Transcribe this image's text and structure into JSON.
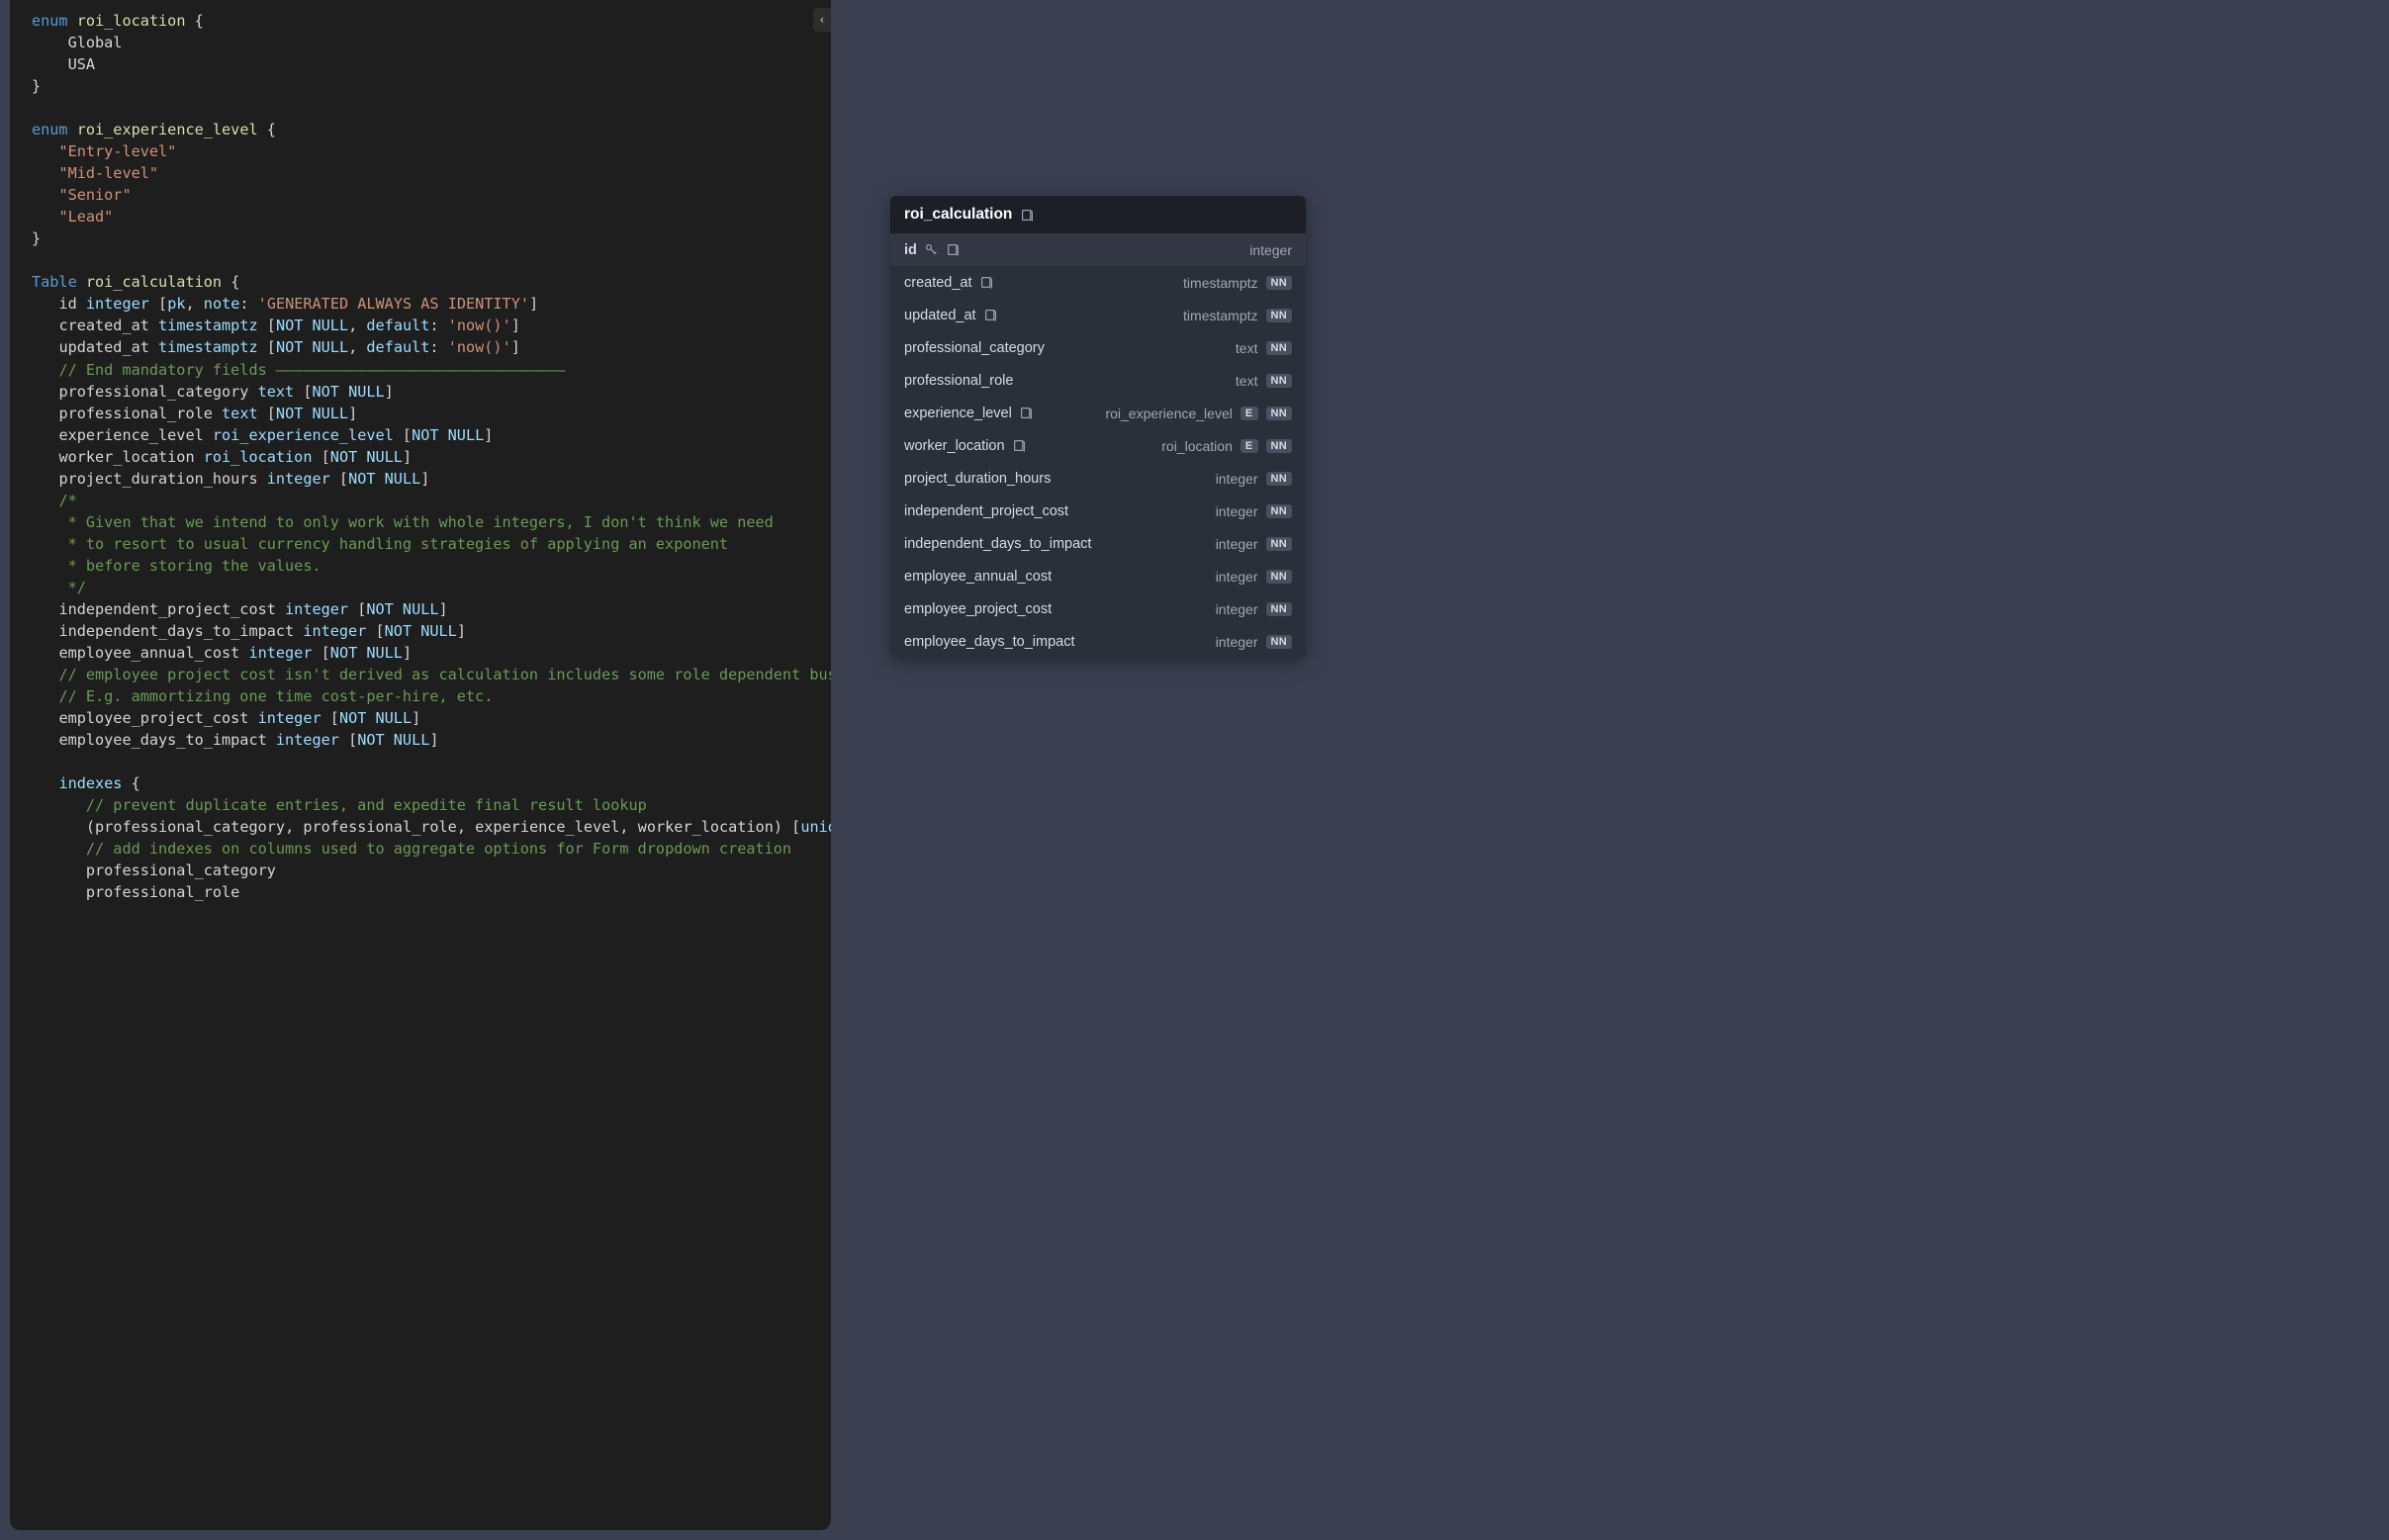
{
  "editor": {
    "code_tokens": [
      [
        [
          "kw",
          "enum"
        ],
        [
          "wht",
          " "
        ],
        [
          "id",
          "roi_location"
        ],
        [
          "wht",
          " "
        ],
        [
          "pun",
          "{"
        ]
      ],
      [
        [
          "wht",
          "    "
        ],
        [
          "wht",
          "Global"
        ]
      ],
      [
        [
          "wht",
          "    "
        ],
        [
          "wht",
          "USA"
        ]
      ],
      [
        [
          "pun",
          "}"
        ]
      ],
      [
        [
          "wht",
          ""
        ]
      ],
      [
        [
          "kw",
          "enum"
        ],
        [
          "wht",
          " "
        ],
        [
          "id",
          "roi_experience_level"
        ],
        [
          "wht",
          " "
        ],
        [
          "pun",
          "{"
        ]
      ],
      [
        [
          "wht",
          "   "
        ],
        [
          "str",
          "\"Entry-level\""
        ]
      ],
      [
        [
          "wht",
          "   "
        ],
        [
          "str",
          "\"Mid-level\""
        ]
      ],
      [
        [
          "wht",
          "   "
        ],
        [
          "str",
          "\"Senior\""
        ]
      ],
      [
        [
          "wht",
          "   "
        ],
        [
          "str",
          "\"Lead\""
        ]
      ],
      [
        [
          "pun",
          "}"
        ]
      ],
      [
        [
          "wht",
          ""
        ]
      ],
      [
        [
          "kw",
          "Table"
        ],
        [
          "wht",
          " "
        ],
        [
          "id",
          "roi_calculation"
        ],
        [
          "wht",
          " "
        ],
        [
          "pun",
          "{"
        ]
      ],
      [
        [
          "wht",
          "   "
        ],
        [
          "wht",
          "id "
        ],
        [
          "typ",
          "integer"
        ],
        [
          "wht",
          " "
        ],
        [
          "pun",
          "["
        ],
        [
          "attr",
          "pk"
        ],
        [
          "pun",
          ", "
        ],
        [
          "attr",
          "note"
        ],
        [
          "pun",
          ": "
        ],
        [
          "str",
          "'GENERATED ALWAYS AS IDENTITY'"
        ],
        [
          "pun",
          "]"
        ]
      ],
      [
        [
          "wht",
          "   "
        ],
        [
          "wht",
          "created_at "
        ],
        [
          "typ",
          "timestamptz"
        ],
        [
          "wht",
          " "
        ],
        [
          "pun",
          "["
        ],
        [
          "attr",
          "NOT NULL"
        ],
        [
          "pun",
          ", "
        ],
        [
          "attr",
          "default"
        ],
        [
          "pun",
          ": "
        ],
        [
          "str",
          "'now()'"
        ],
        [
          "pun",
          "]"
        ]
      ],
      [
        [
          "wht",
          "   "
        ],
        [
          "wht",
          "updated_at "
        ],
        [
          "typ",
          "timestamptz"
        ],
        [
          "wht",
          " "
        ],
        [
          "pun",
          "["
        ],
        [
          "attr",
          "NOT NULL"
        ],
        [
          "pun",
          ", "
        ],
        [
          "attr",
          "default"
        ],
        [
          "pun",
          ": "
        ],
        [
          "str",
          "'now()'"
        ],
        [
          "pun",
          "]"
        ]
      ],
      [
        [
          "wht",
          "   "
        ],
        [
          "com",
          "// End mandatory fields ————————————————————————————————"
        ]
      ],
      [
        [
          "wht",
          "   "
        ],
        [
          "wht",
          "professional_category "
        ],
        [
          "typ",
          "text"
        ],
        [
          "wht",
          " "
        ],
        [
          "pun",
          "["
        ],
        [
          "attr",
          "NOT NULL"
        ],
        [
          "pun",
          "]"
        ]
      ],
      [
        [
          "wht",
          "   "
        ],
        [
          "wht",
          "professional_role "
        ],
        [
          "typ",
          "text"
        ],
        [
          "wht",
          " "
        ],
        [
          "pun",
          "["
        ],
        [
          "attr",
          "NOT NULL"
        ],
        [
          "pun",
          "]"
        ]
      ],
      [
        [
          "wht",
          "   "
        ],
        [
          "wht",
          "experience_level "
        ],
        [
          "typ",
          "roi_experience_level"
        ],
        [
          "wht",
          " "
        ],
        [
          "pun",
          "["
        ],
        [
          "attr",
          "NOT NULL"
        ],
        [
          "pun",
          "]"
        ]
      ],
      [
        [
          "wht",
          "   "
        ],
        [
          "wht",
          "worker_location "
        ],
        [
          "typ",
          "roi_location"
        ],
        [
          "wht",
          " "
        ],
        [
          "pun",
          "["
        ],
        [
          "attr",
          "NOT NULL"
        ],
        [
          "pun",
          "]"
        ]
      ],
      [
        [
          "wht",
          "   "
        ],
        [
          "wht",
          "project_duration_hours "
        ],
        [
          "typ",
          "integer"
        ],
        [
          "wht",
          " "
        ],
        [
          "pun",
          "["
        ],
        [
          "attr",
          "NOT NULL"
        ],
        [
          "pun",
          "]"
        ]
      ],
      [
        [
          "wht",
          "   "
        ],
        [
          "com",
          "/*"
        ]
      ],
      [
        [
          "wht",
          "    "
        ],
        [
          "com",
          "* Given that we intend to only work with whole integers, I don't think we need"
        ]
      ],
      [
        [
          "wht",
          "    "
        ],
        [
          "com",
          "* to resort to usual currency handling strategies of applying an exponent"
        ]
      ],
      [
        [
          "wht",
          "    "
        ],
        [
          "com",
          "* before storing the values."
        ]
      ],
      [
        [
          "wht",
          "    "
        ],
        [
          "com",
          "*/"
        ]
      ],
      [
        [
          "wht",
          "   "
        ],
        [
          "wht",
          "independent_project_cost "
        ],
        [
          "typ",
          "integer"
        ],
        [
          "wht",
          " "
        ],
        [
          "pun",
          "["
        ],
        [
          "attr",
          "NOT NULL"
        ],
        [
          "pun",
          "]"
        ]
      ],
      [
        [
          "wht",
          "   "
        ],
        [
          "wht",
          "independent_days_to_impact "
        ],
        [
          "typ",
          "integer"
        ],
        [
          "wht",
          " "
        ],
        [
          "pun",
          "["
        ],
        [
          "attr",
          "NOT NULL"
        ],
        [
          "pun",
          "]"
        ]
      ],
      [
        [
          "wht",
          "   "
        ],
        [
          "wht",
          "employee_annual_cost "
        ],
        [
          "typ",
          "integer"
        ],
        [
          "wht",
          " "
        ],
        [
          "pun",
          "["
        ],
        [
          "attr",
          "NOT NULL"
        ],
        [
          "pun",
          "]"
        ]
      ],
      [
        [
          "wht",
          "   "
        ],
        [
          "com",
          "// employee project cost isn't derived as calculation includes some role dependent business lo"
        ]
      ],
      [
        [
          "wht",
          "   "
        ],
        [
          "com",
          "// E.g. ammortizing one time cost-per-hire, etc."
        ]
      ],
      [
        [
          "wht",
          "   "
        ],
        [
          "wht",
          "employee_project_cost "
        ],
        [
          "typ",
          "integer"
        ],
        [
          "wht",
          " "
        ],
        [
          "pun",
          "["
        ],
        [
          "attr",
          "NOT NULL"
        ],
        [
          "pun",
          "]"
        ]
      ],
      [
        [
          "wht",
          "   "
        ],
        [
          "wht",
          "employee_days_to_impact "
        ],
        [
          "typ",
          "integer"
        ],
        [
          "wht",
          " "
        ],
        [
          "pun",
          "["
        ],
        [
          "attr",
          "NOT NULL"
        ],
        [
          "pun",
          "]"
        ]
      ],
      [
        [
          "wht",
          ""
        ]
      ],
      [
        [
          "wht",
          "   "
        ],
        [
          "attr",
          "indexes"
        ],
        [
          "wht",
          " "
        ],
        [
          "pun",
          "{"
        ]
      ],
      [
        [
          "wht",
          "      "
        ],
        [
          "com",
          "// prevent duplicate entries, and expedite final result lookup"
        ]
      ],
      [
        [
          "wht",
          "      "
        ],
        [
          "pun",
          "("
        ],
        [
          "wht",
          "professional_category"
        ],
        [
          "pun",
          ", "
        ],
        [
          "wht",
          "professional_role"
        ],
        [
          "pun",
          ", "
        ],
        [
          "wht",
          "experience_level"
        ],
        [
          "pun",
          ", "
        ],
        [
          "wht",
          "worker_location"
        ],
        [
          "pun",
          ") ["
        ],
        [
          "attr",
          "unique"
        ],
        [
          "pun",
          "]"
        ]
      ],
      [
        [
          "wht",
          "      "
        ],
        [
          "com",
          "// add indexes on columns used to aggregate options for Form dropdown creation"
        ]
      ],
      [
        [
          "wht",
          "      "
        ],
        [
          "wht",
          "professional_category"
        ]
      ],
      [
        [
          "wht",
          "      "
        ],
        [
          "wht",
          "professional_role"
        ]
      ]
    ],
    "collapse_glyph": "‹"
  },
  "table": {
    "name": "roi_calculation",
    "columns": [
      {
        "name": "id",
        "type": "integer",
        "pk": true,
        "note": true
      },
      {
        "name": "created_at",
        "type": "timestamptz",
        "nn": true,
        "note": true
      },
      {
        "name": "updated_at",
        "type": "timestamptz",
        "nn": true,
        "note": true
      },
      {
        "name": "professional_category",
        "type": "text",
        "nn": true
      },
      {
        "name": "professional_role",
        "type": "text",
        "nn": true
      },
      {
        "name": "experience_level",
        "type": "roi_experience_level",
        "nn": true,
        "enum": true,
        "note": true
      },
      {
        "name": "worker_location",
        "type": "roi_location",
        "nn": true,
        "enum": true,
        "note": true
      },
      {
        "name": "project_duration_hours",
        "type": "integer",
        "nn": true
      },
      {
        "name": "independent_project_cost",
        "type": "integer",
        "nn": true
      },
      {
        "name": "independent_days_to_impact",
        "type": "integer",
        "nn": true
      },
      {
        "name": "employee_annual_cost",
        "type": "integer",
        "nn": true
      },
      {
        "name": "employee_project_cost",
        "type": "integer",
        "nn": true
      },
      {
        "name": "employee_days_to_impact",
        "type": "integer",
        "nn": true
      }
    ],
    "badges": {
      "nn": "NN",
      "enum": "E"
    }
  }
}
